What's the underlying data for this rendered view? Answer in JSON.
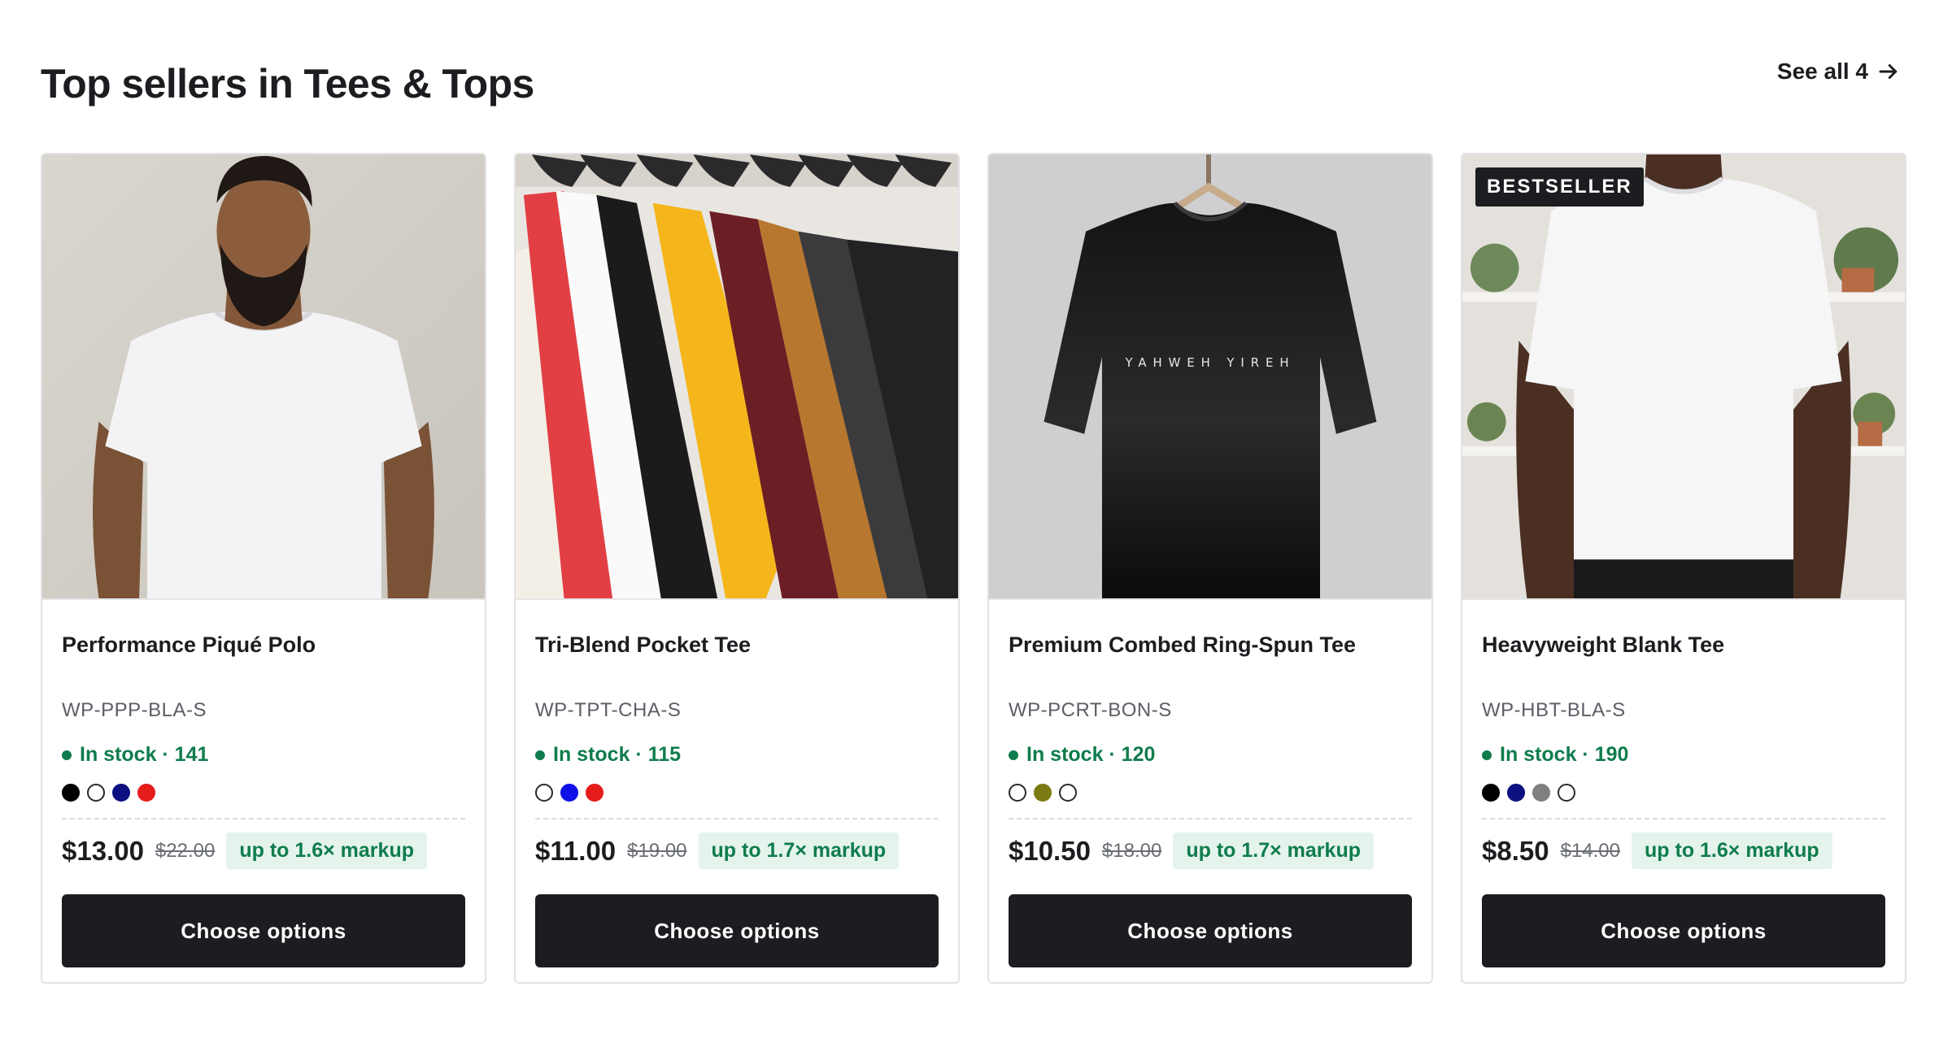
{
  "section": {
    "title": "Top sellers in Tees & Tops",
    "see_all_label": "See all 4"
  },
  "products": [
    {
      "name": "Performance Piqué Polo",
      "sku": "WP-PPP-BLA-S",
      "stock_label": "In stock · 141",
      "price": "$13.00",
      "compare_price": "$22.00",
      "markup": "up to 1.6× markup",
      "cta": "Choose options",
      "badge": "",
      "image_icon": "man-in-white-tee-photo",
      "swatches": [
        "#000000",
        "#ffffff",
        "#0d1080",
        "#e61b1b"
      ]
    },
    {
      "name": "Tri-Blend Pocket Tee",
      "sku": "WP-TPT-CHA-S",
      "stock_label": "In stock · 115",
      "price": "$11.00",
      "compare_price": "$19.00",
      "markup": "up to 1.7× markup",
      "cta": "Choose options",
      "badge": "",
      "image_icon": "tees-on-rack-photo",
      "swatches": [
        "#ffffff",
        "#1010e8",
        "#e61b1b"
      ]
    },
    {
      "name": "Premium Combed Ring-Spun Tee",
      "sku": "WP-PCRT-BON-S",
      "stock_label": "In stock · 120",
      "price": "$10.50",
      "compare_price": "$18.00",
      "markup": "up to 1.7× markup",
      "cta": "Choose options",
      "badge": "",
      "image_icon": "black-tee-on-hanger-photo",
      "image_text": "YAHWEH YIREH",
      "swatches": [
        "#ffffff",
        "#7c7a12",
        "#ffffff"
      ]
    },
    {
      "name": "Heavyweight Blank Tee",
      "sku": "WP-HBT-BLA-S",
      "stock_label": "In stock · 190",
      "price": "$8.50",
      "compare_price": "$14.00",
      "markup": "up to 1.6× markup",
      "cta": "Choose options",
      "badge": "BESTSELLER",
      "image_icon": "model-white-tee-photo",
      "swatches": [
        "#000000",
        "#0d1080",
        "#808080",
        "#ffffff"
      ]
    }
  ],
  "colors": {
    "primary": "#1c1d20",
    "in_stock": "#0f7c4c",
    "markup_bg": "#e4f4ec"
  }
}
